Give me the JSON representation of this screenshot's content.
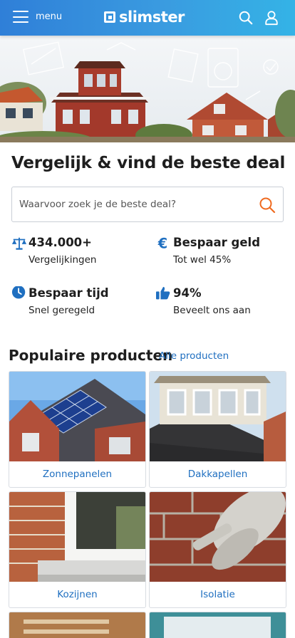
{
  "header": {
    "menu_label": "menu",
    "logo_text": "slimster",
    "brand_color": "#2f7fd8"
  },
  "hero": {
    "image": "illustrated houses banner"
  },
  "main": {
    "headline": "Vergelijk & vind de beste deal",
    "search": {
      "placeholder": "Waarvoor zoek je de beste deal?",
      "value": ""
    },
    "usps": [
      {
        "icon": "scale-icon",
        "title": "434.000+",
        "subtitle": "Vergelijkingen"
      },
      {
        "icon": "euro-icon",
        "title": "Bespaar geld",
        "subtitle": "Tot wel 45%"
      },
      {
        "icon": "clock-icon",
        "title": "Bespaar tijd",
        "subtitle": "Snel geregeld"
      },
      {
        "icon": "thumbs-up-icon",
        "title": "94%",
        "subtitle": "Beveelt ons aan"
      }
    ]
  },
  "popular": {
    "title": "Populaire producten",
    "all_link": "Alle producten",
    "products": [
      {
        "label": "Zonnepanelen"
      },
      {
        "label": "Dakkapellen"
      },
      {
        "label": "Kozijnen"
      },
      {
        "label": "Isolatie"
      }
    ]
  }
}
